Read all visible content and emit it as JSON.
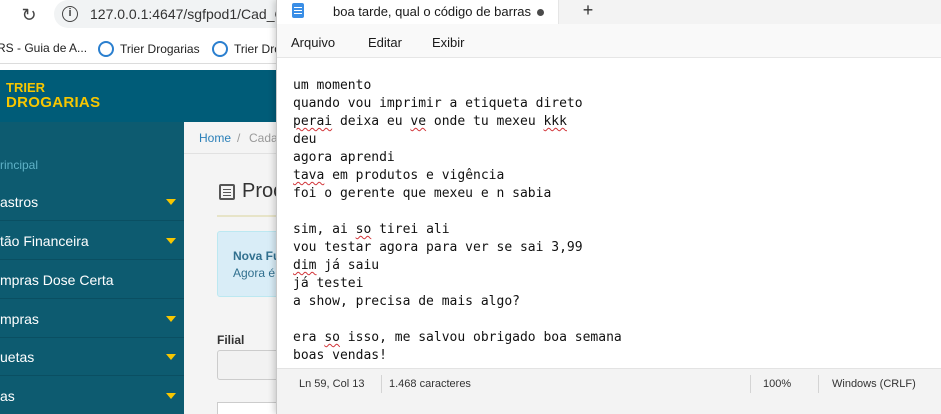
{
  "browser": {
    "url": "127.0.0.1:4647/sgfpod1/Cad_C",
    "bookmarks": [
      {
        "label": "RS - Guia de A..."
      },
      {
        "label": "Trier Drogarias"
      },
      {
        "label": "Trier Dro"
      }
    ]
  },
  "app": {
    "logo_top": "TRIER",
    "logo_bottom": "DROGARIAS",
    "sidebar": {
      "section": "rincipal",
      "items": [
        {
          "label": "astros"
        },
        {
          "label": "tão Financeira"
        },
        {
          "label": "mpras Dose Certa"
        },
        {
          "label": "mpras"
        },
        {
          "label": "uetas"
        },
        {
          "label": "as"
        }
      ]
    },
    "breadcrumb": {
      "home": "Home",
      "sep": "/",
      "current": "Cada"
    },
    "page_title": "Proc",
    "alert": {
      "title": "Nova Fu",
      "text": "Agora é"
    },
    "filial_label": "Filial"
  },
  "notepad": {
    "tab_title": "boa tarde, qual o código de barras",
    "menu": [
      "Arquivo",
      "Editar",
      "Exibir"
    ],
    "lines": [
      {
        "pre": "um momento",
        "sq": "",
        "post": ""
      },
      {
        "pre": "quando vou imprimir a etiqueta direto",
        "sq": "",
        "post": ""
      },
      {
        "pre": "",
        "sq": "perai",
        "post": " deixa eu "
      },
      {
        "pre": "deu",
        "sq": "",
        "post": ""
      },
      {
        "pre": "agora aprendi",
        "sq": "",
        "post": ""
      },
      {
        "pre": "",
        "sq": "tava",
        "post": " em produtos e vigência"
      },
      {
        "pre": "foi o gerente que mexeu e n sabia",
        "sq": "",
        "post": ""
      },
      {
        "pre": "",
        "sq": "",
        "post": ""
      },
      {
        "pre": "sim, ai ",
        "sq": "so",
        "post": " tirei ali"
      },
      {
        "pre": "vou testar agora para ver se sai 3,99",
        "sq": "",
        "post": ""
      },
      {
        "pre": "",
        "sq": "dim",
        "post": " já saiu"
      },
      {
        "pre": "já testei",
        "sq": "",
        "post": ""
      },
      {
        "pre": "a show, precisa de mais algo?",
        "sq": "",
        "post": ""
      },
      {
        "pre": "",
        "sq": "",
        "post": ""
      },
      {
        "pre": "era ",
        "sq": "so",
        "post": " isso, me salvou obrigado boa semana"
      },
      {
        "pre": "boas vendas!",
        "sq": "",
        "post": ""
      }
    ],
    "line3_ve": "ve",
    "line3_mid": " onde tu mexeu ",
    "line3_kkk": "kkk",
    "status": {
      "position": "Ln 59, Col 13",
      "chars": "1.468 caracteres",
      "zoom": "100%",
      "eol": "Windows (CRLF)"
    }
  }
}
